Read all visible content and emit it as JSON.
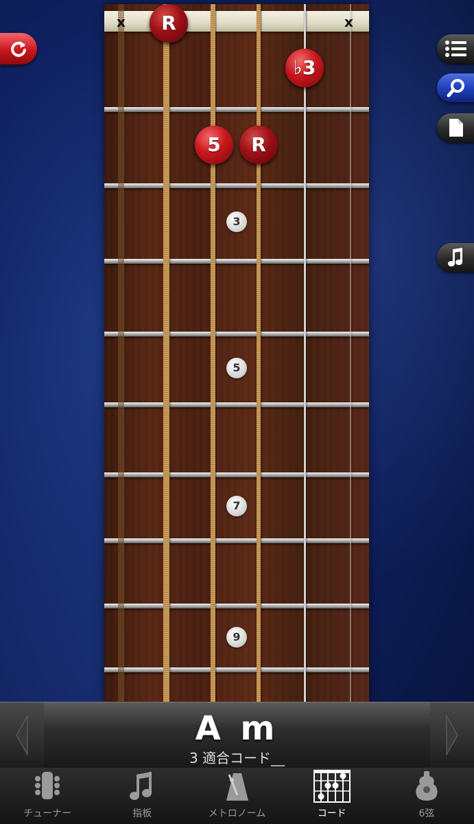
{
  "fretboard": {
    "muted_marks": [
      "x",
      "x"
    ],
    "fret_inlays": [
      "3",
      "5",
      "7",
      "9"
    ],
    "chord_notes": [
      {
        "label": "R",
        "role": "root"
      },
      {
        "label": "♭3",
        "role": "minor-third"
      },
      {
        "label": "5",
        "role": "fifth"
      },
      {
        "label": "R",
        "role": "root"
      }
    ]
  },
  "chord": {
    "name": "A m",
    "subtitle": "3 適合コード__"
  },
  "tabs": [
    {
      "label": "チューナー",
      "icon": "tuner-headstock-icon"
    },
    {
      "label": "指板",
      "icon": "music-note-icon"
    },
    {
      "label": "メトロノーム",
      "icon": "metronome-icon"
    },
    {
      "label": "コード",
      "icon": "chord-diagram-icon",
      "active": true
    },
    {
      "label": "6弦",
      "icon": "guitar-body-icon"
    }
  ],
  "colors": {
    "note_red": "#c8161c",
    "background_blue": "#0f2160",
    "active_tab_text": "#ffffff"
  }
}
